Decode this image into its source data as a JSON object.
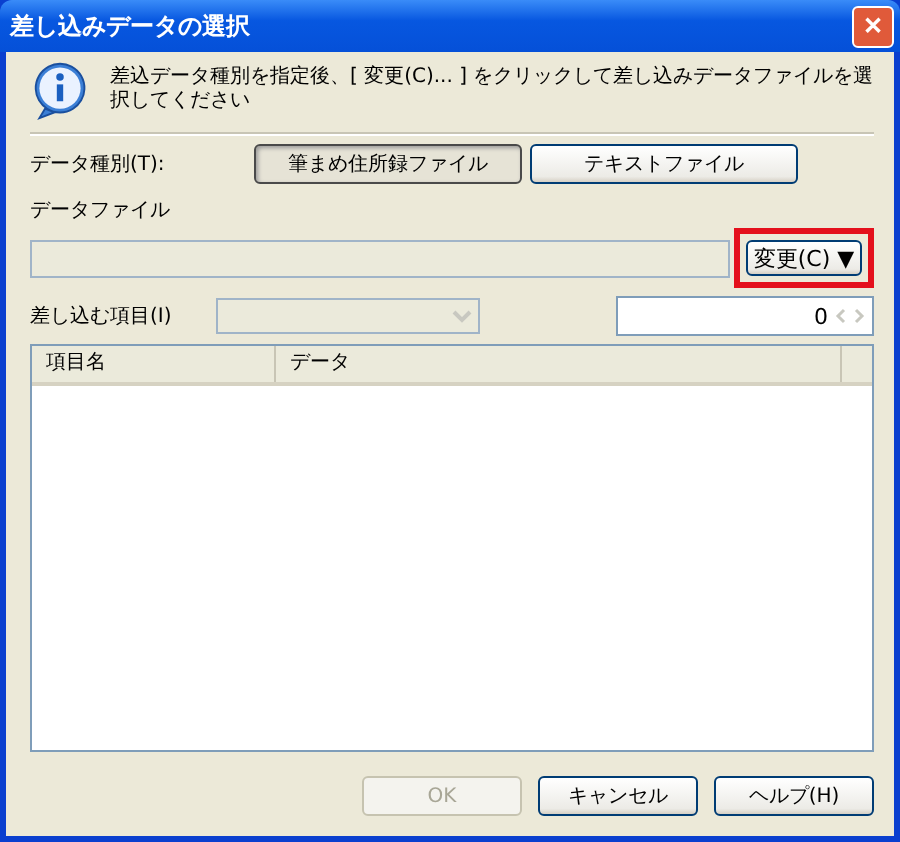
{
  "window": {
    "title": "差し込みデータの選択",
    "close": "✕"
  },
  "info": {
    "message": "差込データ種別を指定後、[ 変更(C)... ] をクリックして差し込みデータファイルを選択してください"
  },
  "data_type": {
    "label": "データ種別(T):",
    "options": [
      {
        "label": "筆まめ住所録ファイル",
        "selected": true
      },
      {
        "label": "テキストファイル",
        "selected": false
      }
    ]
  },
  "data_file": {
    "label": "データファイル",
    "change_button": "変更(C) ▼",
    "highlighted": true
  },
  "merge_item": {
    "label": "差し込む項目(I)",
    "combo_disabled": true,
    "count": "0"
  },
  "table": {
    "columns": [
      "項目名",
      "データ"
    ]
  },
  "buttons": [
    {
      "label": "OK",
      "disabled": true
    },
    {
      "label": "キャンセル",
      "disabled": false
    },
    {
      "label": "ヘルプ(H)",
      "disabled": false
    }
  ]
}
